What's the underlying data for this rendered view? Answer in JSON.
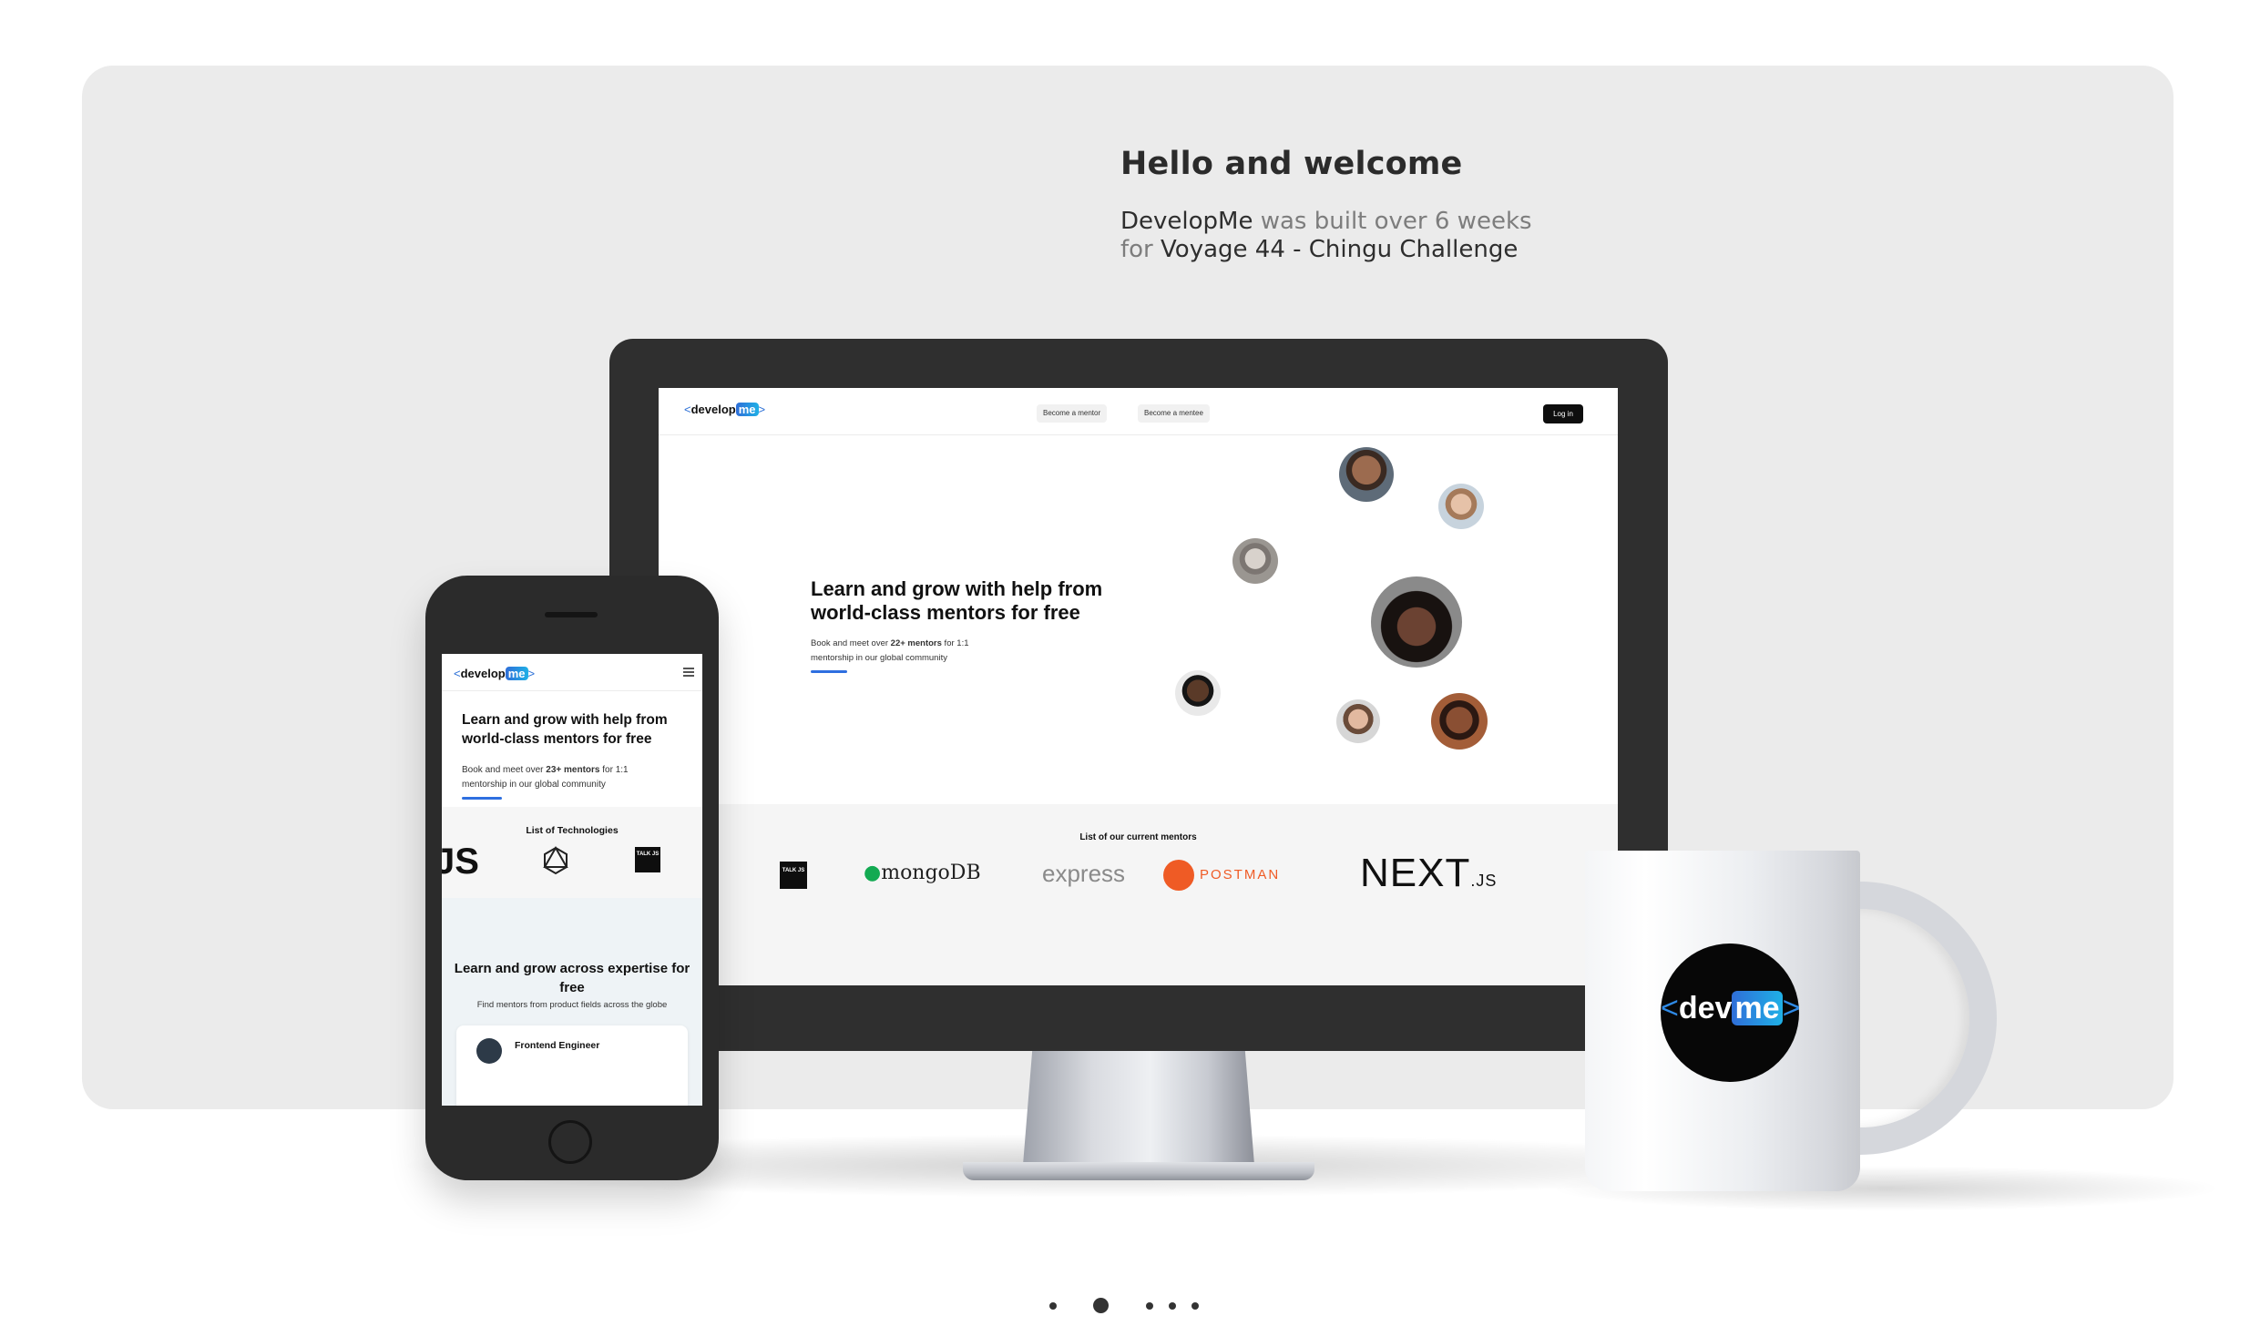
{
  "welcome": {
    "title": "Hello and welcome",
    "line1_name": "DevelopMe",
    "line1_rest": " was built over 6 weeks",
    "line2_for": "for ",
    "line2_event": "Voyage 44 - Chingu Challenge"
  },
  "desktop_site": {
    "logo": {
      "open": "<",
      "develop": "develop",
      "me": "me",
      "close": ">"
    },
    "nav": {
      "mentor_button": "Become a mentor",
      "mentee_button": "Become a mentee",
      "login_button": "Log in"
    },
    "hero": {
      "heading": "Learn and grow with help from world-class mentors for free",
      "body_pre": "Book and meet over ",
      "body_bold": "22+ mentors",
      "body_post": " for 1:1 mentorship in our global community"
    },
    "mentors_section_title": "List of our current mentors",
    "tech_logos": [
      "talk-js-logo",
      "mongodb-logo",
      "express-logo",
      "postman-logo",
      "nextjs-logo"
    ],
    "tech_labels": {
      "mongodb": "mongoDB",
      "express": "express",
      "postman": "POSTMAN",
      "next": "NEXT",
      "next_suffix": ".JS",
      "talk": "TALK JS"
    }
  },
  "mobile_site": {
    "logo": {
      "open": "<",
      "develop": "develop",
      "me": "me",
      "close": ">"
    },
    "hero": {
      "heading": "Learn and grow with help from world-class mentors for free",
      "body_pre": "Book and meet over ",
      "body_bold": "23+ mentors",
      "body_post": " for 1:1 mentorship in our global community"
    },
    "technologies_title": "List of Technologies",
    "tech_partial": "JS",
    "tech_talk": "TALK JS",
    "expertise_heading": "Learn and grow across expertise for free",
    "expertise_sub": "Find mentors from product fields across the globe",
    "card_title": "Frontend Engineer"
  },
  "mug": {
    "logo": {
      "open": "<",
      "dev": "dev",
      "me": "me",
      "close": ">"
    }
  },
  "carousel": {
    "dot_count": 5,
    "active_index": 1
  },
  "colors": {
    "accent_blue": "#2e6fe0",
    "card_bg": "#ebebeb",
    "login_bg": "#0e0e0e"
  }
}
